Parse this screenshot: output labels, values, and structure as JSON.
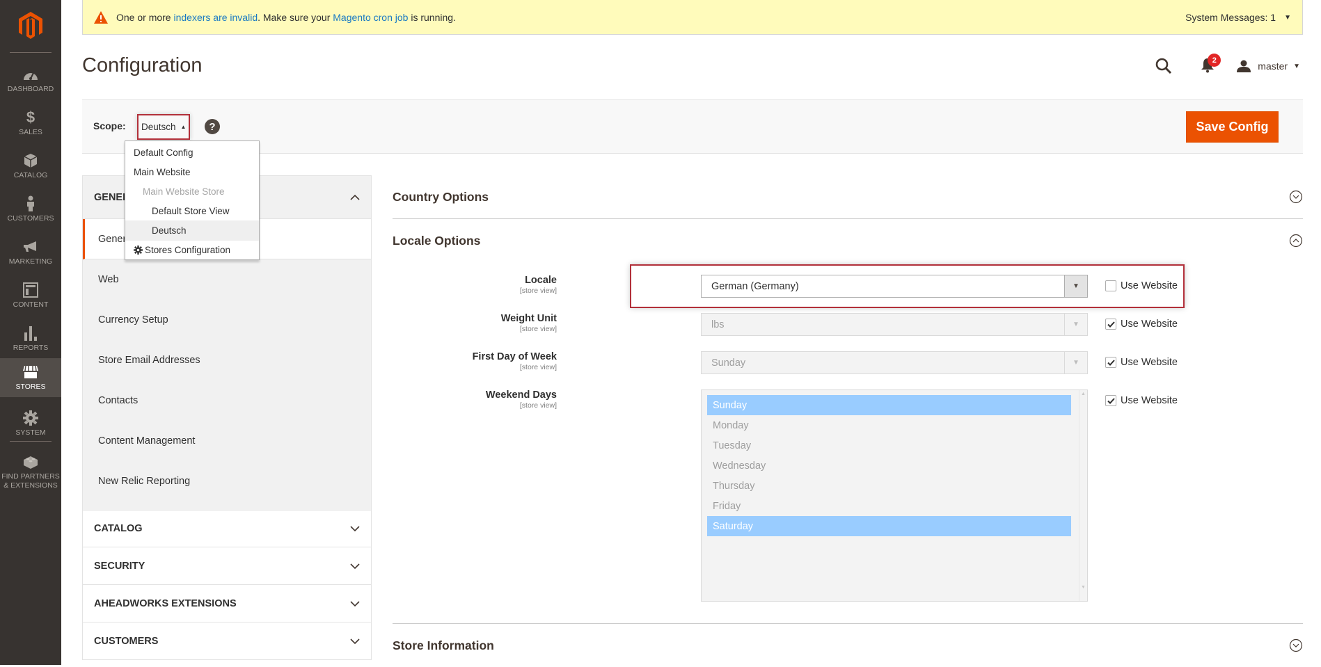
{
  "sidebar": {
    "logo": "magento-logo",
    "items": [
      {
        "label": "DASHBOARD",
        "icon": "dashboard-icon"
      },
      {
        "label": "SALES",
        "icon": "dollar-icon"
      },
      {
        "label": "CATALOG",
        "icon": "box-icon"
      },
      {
        "label": "CUSTOMERS",
        "icon": "person-icon"
      },
      {
        "label": "MARKETING",
        "icon": "megaphone-icon"
      },
      {
        "label": "CONTENT",
        "icon": "layout-icon"
      },
      {
        "label": "REPORTS",
        "icon": "bar-chart-icon"
      },
      {
        "label": "STORES",
        "icon": "storefront-icon",
        "active": true
      },
      {
        "label": "SYSTEM",
        "icon": "gear-icon"
      },
      {
        "label_line1": "FIND PARTNERS",
        "label_line2": "& EXTENSIONS",
        "icon": "lego-brick-icon"
      }
    ]
  },
  "message": {
    "prefix": "One or more ",
    "link1": "indexers are invalid",
    "middle": ". Make sure your ",
    "link2": "Magento cron job",
    "suffix": " is running.",
    "system_messages": "System Messages: 1"
  },
  "header": {
    "title": "Configuration",
    "notifications_count": "2",
    "user": "master"
  },
  "scope": {
    "label": "Scope:",
    "current": "Deutsch",
    "help": "?",
    "options": [
      {
        "label": "Default Config"
      },
      {
        "label": "Main Website"
      },
      {
        "label": "Main Website Store"
      },
      {
        "label": "Default Store View"
      },
      {
        "label": "Deutsch"
      }
    ],
    "stores_config": "Stores Configuration"
  },
  "toolbar": {
    "save_label": "Save Config"
  },
  "leftnav": {
    "general": {
      "title": "GENERAL",
      "items": [
        "General",
        "Web",
        "Currency Setup",
        "Store Email Addresses",
        "Contacts",
        "Content Management",
        "New Relic Reporting"
      ]
    },
    "sections": [
      "CATALOG",
      "SECURITY",
      "AHEADWORKS EXTENSIONS",
      "CUSTOMERS"
    ]
  },
  "content": {
    "country_options": "Country Options",
    "locale_options": "Locale Options",
    "store_information": "Store Information",
    "scope_hint": "[store view]",
    "use_website": "Use Website",
    "fields": {
      "locale": {
        "label": "Locale",
        "value": "German (Germany)",
        "use_website": false
      },
      "weight_unit": {
        "label": "Weight Unit",
        "value": "lbs",
        "use_website": true
      },
      "first_day": {
        "label": "First Day of Week",
        "value": "Sunday",
        "use_website": true
      },
      "weekend_days": {
        "label": "Weekend Days",
        "use_website": true,
        "options": [
          "Sunday",
          "Monday",
          "Tuesday",
          "Wednesday",
          "Thursday",
          "Friday",
          "Saturday"
        ],
        "selected": [
          "Sunday",
          "Saturday"
        ]
      }
    }
  },
  "colors": {
    "accent": "#eb5202",
    "sidebar": "#373330",
    "highlight_border": "#b2303a",
    "selected_option": "#99ccff",
    "message_bg": "#fffbbb"
  }
}
